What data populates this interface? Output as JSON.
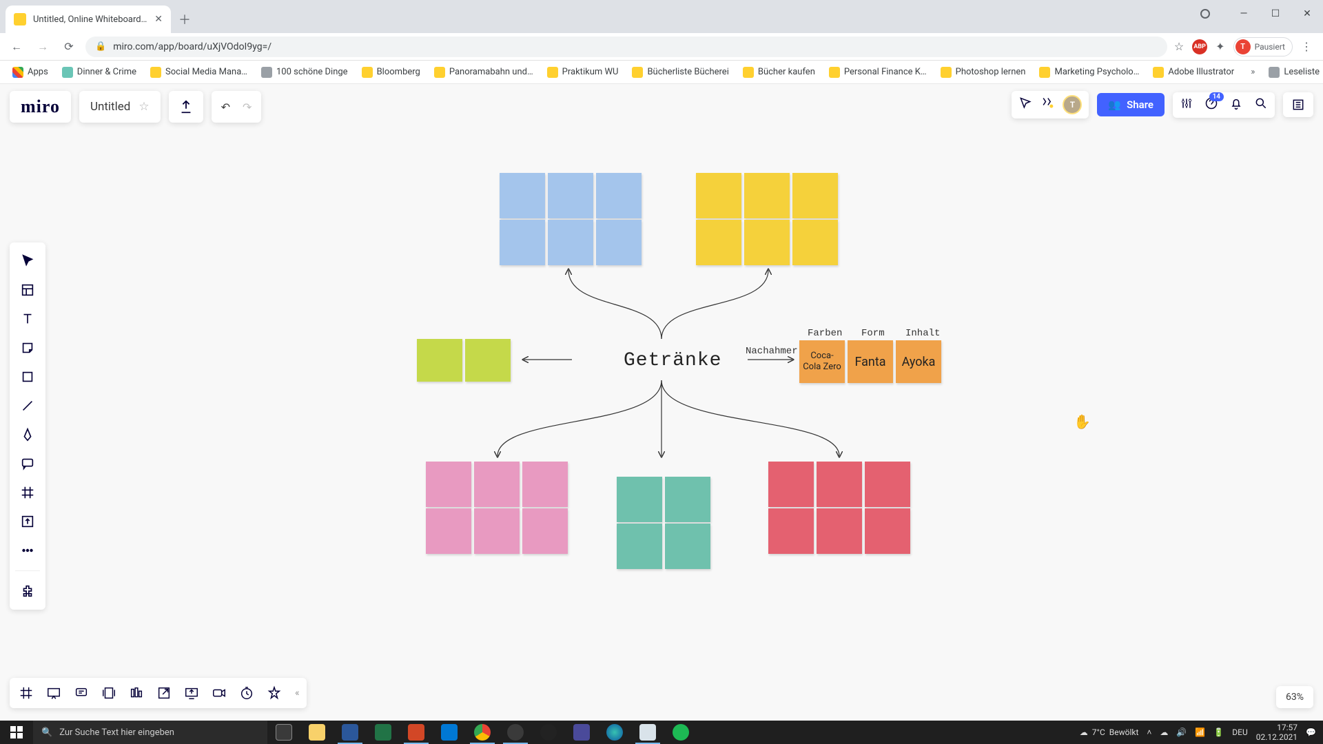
{
  "browser": {
    "tab_title": "Untitled, Online Whiteboard for",
    "url": "miro.com/app/board/uXjVOdoI9yg=/",
    "profile_state": "Pausiert",
    "profile_initial": "T",
    "bookmarks": [
      "Apps",
      "Dinner & Crime",
      "Social Media Mana…",
      "100 schöne Dinge",
      "Bloomberg",
      "Panoramabahn und…",
      "Praktikum WU",
      "Bücherliste Bücherei",
      "Bücher kaufen",
      "Personal Finance K…",
      "Photoshop lernen",
      "Marketing Psycholo…",
      "Adobe Illustrator"
    ],
    "reading_list": "Leseliste"
  },
  "miro": {
    "board_title": "Untitled",
    "share_label": "Share",
    "help_badge": "14",
    "avatar_initial": "T",
    "zoom": "63%"
  },
  "canvas": {
    "center_label": "Getränke",
    "nachahmer_label": "Nachahmer",
    "headers": {
      "farben": "Farben",
      "form": "Form",
      "inhalt": "Inhalt"
    },
    "orange": {
      "a": "Coca-Cola Zero",
      "b": "Fanta",
      "c": "Ayoka"
    }
  },
  "taskbar": {
    "search_placeholder": "Zur Suche Text hier eingeben",
    "weather_temp": "7°C",
    "weather_desc": "Bewölkt",
    "lang": "DEU",
    "time": "17:57",
    "date": "02.12.2021"
  }
}
